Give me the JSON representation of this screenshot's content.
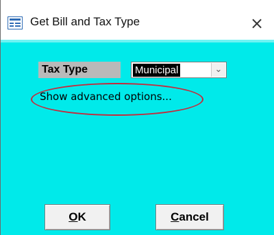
{
  "window": {
    "title": "Get Bill and Tax Type",
    "close_glyph": "×"
  },
  "form": {
    "tax_type_label": "Tax Type",
    "tax_type_value": "Municipal",
    "combo_arrow_glyph": "⌄",
    "advanced_link": "Show advanced options..."
  },
  "buttons": {
    "ok_mnemonic": "O",
    "ok_rest": "K",
    "cancel_mnemonic": "C",
    "cancel_rest": "ancel"
  },
  "colors": {
    "client_background": "#00eaea",
    "highlight_ring": "#c8283a",
    "label_background": "#b9b9b9"
  },
  "icons": {
    "app": "form-window-icon",
    "close": "close-icon",
    "dropdown": "chevron-down-icon"
  }
}
